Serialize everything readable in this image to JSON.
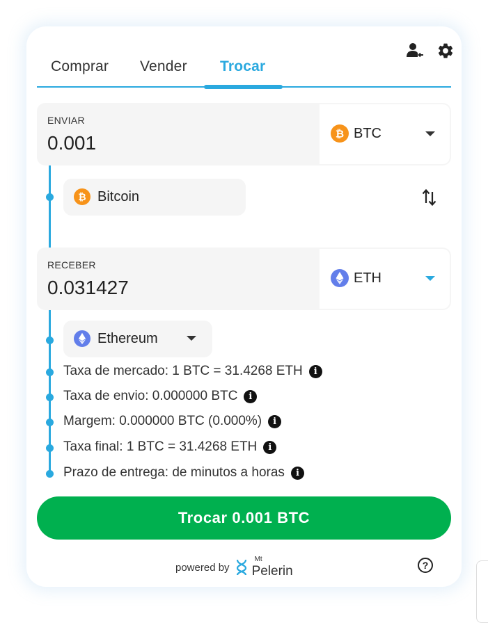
{
  "tabs": [
    {
      "label": "Comprar"
    },
    {
      "label": "Vender"
    },
    {
      "label": "Trocar"
    }
  ],
  "header_icons": [
    "user-switch-icon",
    "gear-icon"
  ],
  "send": {
    "label": "ENVIAR",
    "amount": "0.001",
    "currency": "BTC",
    "currency_icon": "bitcoin-icon",
    "network": "Bitcoin"
  },
  "receive": {
    "label": "RECEBER",
    "amount": "0.031427",
    "currency": "ETH",
    "currency_icon": "ethereum-icon",
    "network": "Ethereum"
  },
  "details": [
    {
      "text": "Taxa de mercado: 1 BTC = 31.4268 ETH"
    },
    {
      "text": "Taxa de envio: 0.000000 BTC"
    },
    {
      "text": "Margem: 0.000000 BTC (0.000%)"
    },
    {
      "text": "Taxa final: 1 BTC = 31.4268 ETH"
    },
    {
      "text": "Prazo de entrega: de minutos a horas"
    }
  ],
  "cta_label": "Trocar 0.001 BTC",
  "footer": {
    "powered_by": "powered by",
    "brand_small": "Mt",
    "brand": "Pelerin"
  },
  "colors": {
    "accent": "#2aa9df",
    "cta": "#00b04f",
    "bitcoin": "#f7931a",
    "ethereum": "#627eea"
  }
}
